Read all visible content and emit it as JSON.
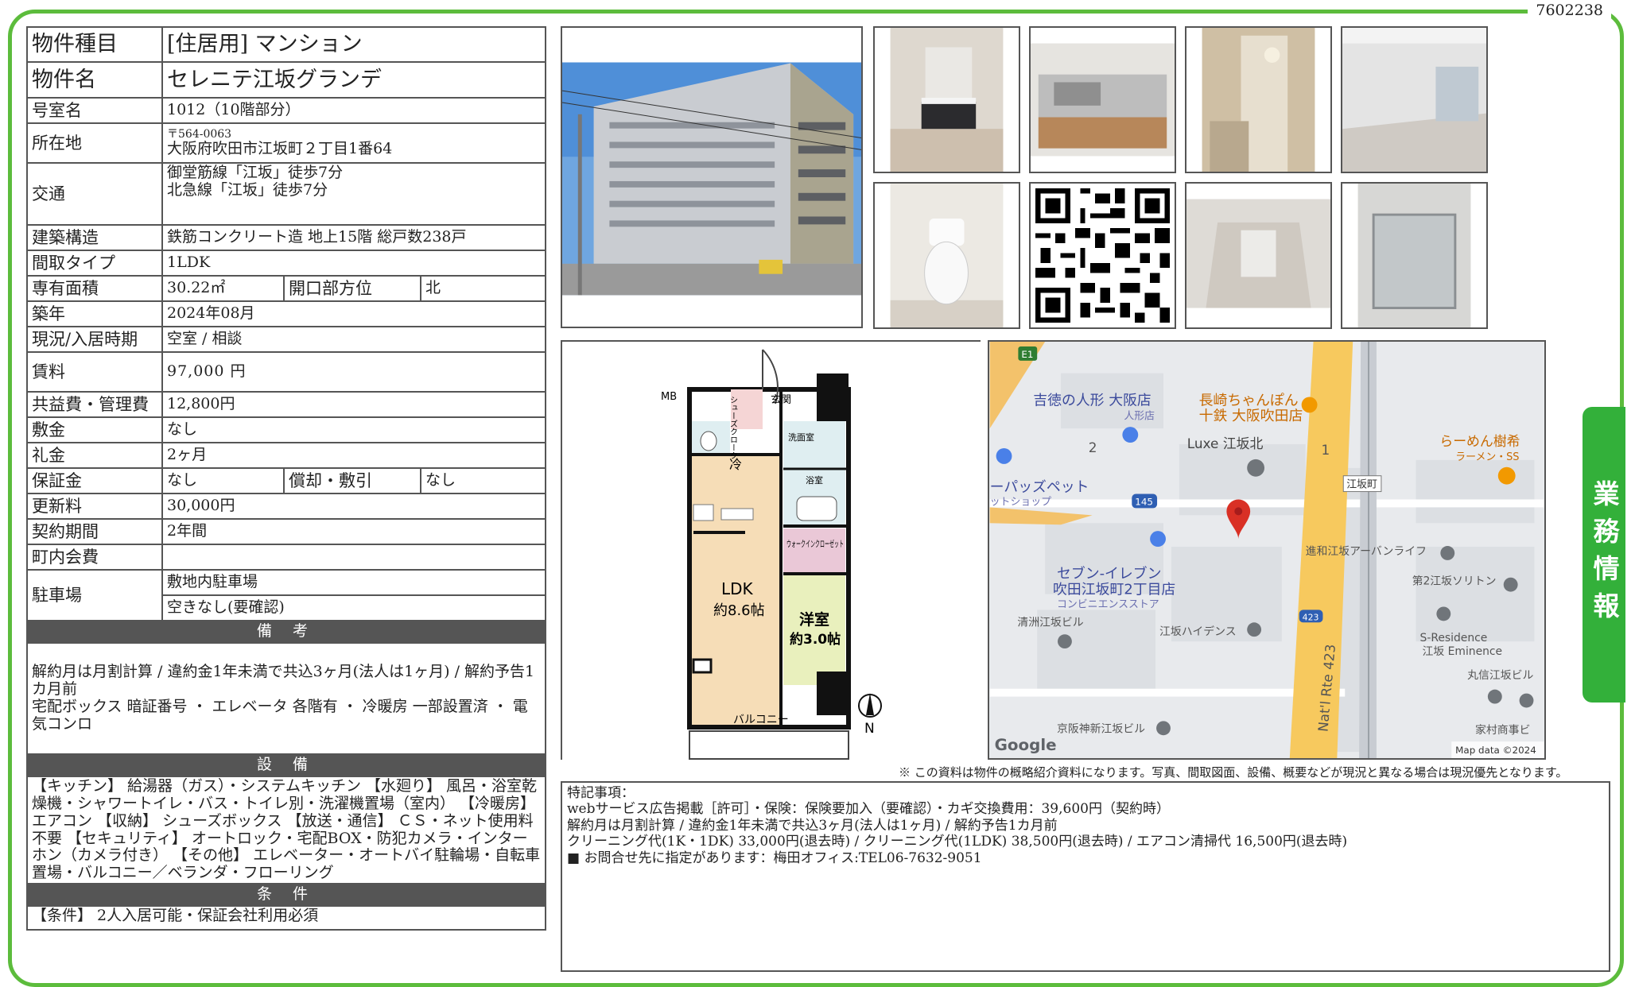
{
  "doc_id": "7602238",
  "side_tab": "業務情報",
  "table": {
    "type_label": "物件種目",
    "type_value": "[住居用] マンション",
    "name_label": "物件名",
    "name_value": "セレニテ江坂グランデ",
    "room_label": "号室名",
    "room_value": "1012（10階部分）",
    "address_label": "所在地",
    "address_zip": "〒564-0063",
    "address_value": "大阪府吹田市江坂町２丁目1番64",
    "transit_label": "交通",
    "transit_1": "御堂筋線「江坂」徒歩7分",
    "transit_2": "北急線「江坂」徒歩7分",
    "structure_label": "建築構造",
    "structure_value": "鉄筋コンクリート造 地上15階 総戸数238戸",
    "layout_label": "間取タイプ",
    "layout_value": "1LDK",
    "area_label": "専有面積",
    "area_value": "30.22㎡",
    "direction_label": "開口部方位",
    "direction_value": "北",
    "built_label": "築年",
    "built_value": "2024年08月",
    "status_label": "現況/入居時期",
    "status_value": "空室 / 相談",
    "rent_label": "賃料",
    "rent_value": "97,000 円",
    "fee_label": "共益費・管理費",
    "fee_value": "12,800円",
    "deposit_label": "敷金",
    "deposit_value": "なし",
    "key_money_label": "礼金",
    "key_money_value": "2ヶ月",
    "guarantee_label": "保証金",
    "guarantee_value": "なし",
    "amort_label": "償却・敷引",
    "amort_value": "なし",
    "renewal_label": "更新料",
    "renewal_value": "30,000円",
    "contract_label": "契約期間",
    "contract_value": "2年間",
    "community_label": "町内会費",
    "community_value": "",
    "parking_label": "駐車場",
    "parking_1": "敷地内駐車場",
    "parking_2": "空きなし(要確認)"
  },
  "notes": {
    "heading": "備 考",
    "line1": "解約月は月割計算 / 違約金1年未満で共込3ヶ月(法人は1ヶ月) / 解約予告1カ月前",
    "line2": "宅配ボックス 暗証番号 ・ エレベータ 各階有 ・ 冷暖房 一部設置済 ・ 電気コンロ"
  },
  "equipment": {
    "heading": "設 備",
    "text": "【キッチン】 給湯器（ガス）・システムキッチン 【水廻り】 風呂・浴室乾燥機・シャワートイレ・バス・トイレ別・洗濯機置場（室内） 【冷暖房】 エアコン 【収納】 シューズボックス 【放送・通信】 ＣＳ・ネット使用料不要 【セキュリティ】 オートロック・宅配BOX・防犯カメラ・インターホン（カメラ付き） 【その他】 エレベーター・オートバイ駐輪場・自転車置場・バルコニー／ベランダ・フローリング"
  },
  "conditions": {
    "heading": "条 件",
    "text": "【条件】 2人入居可能・保証会社利用必須"
  },
  "floorplan": {
    "mb": "MB",
    "shoes": "シューズクローク",
    "entrance": "玄関",
    "wash": "洗面室",
    "bath": "浴室",
    "fridge": "冷",
    "walkin": "ウォークインクローゼット",
    "ldk": "LDK",
    "ldk_size": "約8.6帖",
    "western": "洋室",
    "western_size": "約3.0帖",
    "balcony": "バルコニー",
    "north": "N"
  },
  "map": {
    "labels": {
      "yoshitoku": "吉徳の人形 大阪店",
      "ningyo": "人形店",
      "nagasaki1": "長崎ちゃんぽん",
      "nagasaki2": "十鉄 大阪吹田店",
      "luxe": "Luxe 江坂北",
      "ramen1": "らーめん樹希",
      "ramen2": "ラーメン・SS",
      "pets1": "ーパッズペット",
      "pets2": "ットショップ",
      "esaka_town": "江坂町",
      "road145": "145",
      "e1": "E1",
      "seven1": "セブン-イレブン",
      "seven2": "吹田江坂町2丁目店",
      "seven3": "コンビニエンスストア",
      "shinwa": "進和江坂アーバンライフ",
      "soriton": "第2江坂ソリトン",
      "kiyosu": "清洲江坂ビル",
      "heights": "江坂ハイデンス",
      "sres1": "S-Residence",
      "sres2": "江坂 Eminence",
      "road423": "423",
      "nat": "Nat'l Rte 423",
      "marushin": "丸信江坂ビル",
      "keihan": "京阪神新江坂ビル",
      "kamura": "家村商事ビ",
      "num2": "2",
      "num1": "1",
      "google": "Google",
      "mapdata": "Map data ©2024"
    }
  },
  "disclaimer": "※ この資料は物件の概略紹介資料になります。写真、間取図面、設備、概要などが現況と異なる場合は現況優先となります。",
  "remarks": {
    "line1": "特記事項：",
    "line2": "webサービス広告掲載［許可］・保険：保険要加入（要確認）・カギ交換費用：39,600円（契約時）",
    "line3": "解約月は月割計算 / 違約金1年未満で共込3ヶ月(法人は1ヶ月) / 解約予告1カ月前",
    "line4": "クリーニング代(1K・1DK) 33,000円(退去時) / クリーニング代(1LDK) 38,500円(退去時) / エアコン清掃代 16,500円(退去時)",
    "line5": "■ お問合せ先に指定があります：梅田オフィス:TEL06-7632-9051"
  },
  "colors": {
    "frame": "#5cbc3c",
    "side_tab": "#33b03a",
    "section_header": "#555555",
    "map_road": "#f7c95e"
  }
}
